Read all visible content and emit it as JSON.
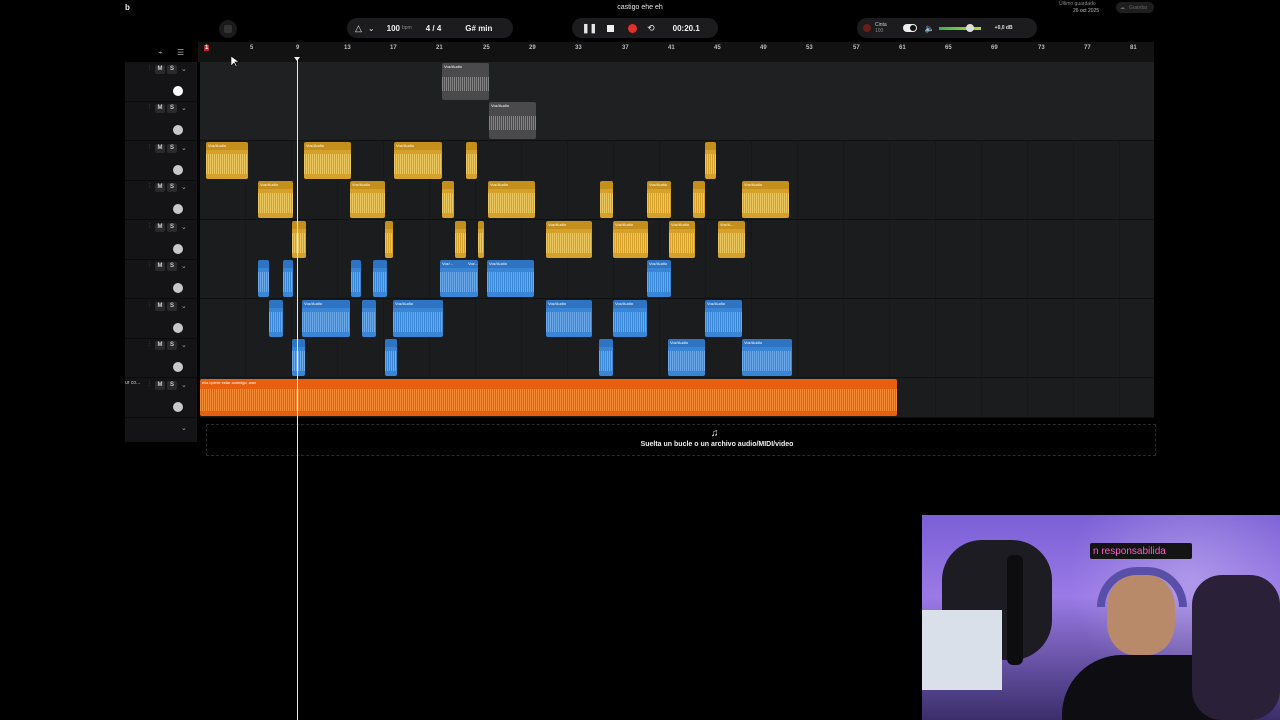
{
  "app": {
    "corner_letter": "b",
    "project_title": "castigo ehe eh",
    "saved_label": "Último guardado",
    "saved_date": "26 oct 2025",
    "save_button": "Guardar"
  },
  "transport": {
    "bpm": "100",
    "bpm_unit": "bpm",
    "time_signature": "4 / 4",
    "key": "G# min",
    "time": "00:20.1",
    "tape_label": "Cinta",
    "tape_value": "100",
    "volume_db": "+0,0 dB"
  },
  "ruler": {
    "bars": [
      "1",
      "5",
      "9",
      "13",
      "17",
      "21",
      "25",
      "29",
      "33",
      "37",
      "41",
      "45",
      "49",
      "53",
      "57",
      "61",
      "65",
      "69",
      "73",
      "77",
      "81"
    ]
  },
  "tracks": [
    {
      "mute": "M",
      "solo": "S",
      "clips": [
        {
          "label": "Voz/Audio",
          "color": "gray"
        }
      ]
    },
    {
      "mute": "M",
      "solo": "S",
      "clips": [
        {
          "label": "Voz/Audio",
          "color": "gray"
        }
      ]
    },
    {
      "mute": "M",
      "solo": "S",
      "clips": [
        {
          "label": "Voz/Audio",
          "color": "gold"
        },
        {
          "label": "Voz/Audio",
          "color": "gold"
        },
        {
          "label": "Voz/Audio",
          "color": "gold"
        },
        {
          "label": "",
          "color": "gold"
        },
        {
          "label": "",
          "color": "gold"
        }
      ]
    },
    {
      "mute": "M",
      "solo": "S",
      "clips": [
        {
          "label": "Voz/Audio",
          "color": "gold"
        },
        {
          "label": "Voz/Audio",
          "color": "gold"
        },
        {
          "label": "",
          "color": "gold"
        },
        {
          "label": "Voz/Audio",
          "color": "gold"
        },
        {
          "label": "",
          "color": "gold"
        },
        {
          "label": "Voz/Audio",
          "color": "gold"
        },
        {
          "label": "",
          "color": "gold"
        },
        {
          "label": "Voz/Audio",
          "color": "gold"
        }
      ]
    },
    {
      "mute": "M",
      "solo": "S",
      "clips": [
        {
          "label": "",
          "color": "gold"
        },
        {
          "label": "",
          "color": "gold"
        },
        {
          "label": "",
          "color": "gold"
        },
        {
          "label": "",
          "color": "gold"
        },
        {
          "label": "Voz/Audio",
          "color": "gold"
        },
        {
          "label": "Voz/Audio",
          "color": "gold"
        },
        {
          "label": "Voz/Audio",
          "color": "gold"
        },
        {
          "label": "Voz/A...",
          "color": "gold"
        }
      ]
    },
    {
      "mute": "M",
      "solo": "S",
      "clips": [
        {
          "label": "",
          "color": "blue"
        },
        {
          "label": "",
          "color": "blue"
        },
        {
          "label": "",
          "color": "blue"
        },
        {
          "label": "",
          "color": "blue"
        },
        {
          "label": "Voz/...",
          "color": "blue"
        },
        {
          "label": "Voz...",
          "color": "blue"
        },
        {
          "label": "Voz/Audio",
          "color": "blue"
        },
        {
          "label": "Voz/Audio",
          "color": "blue"
        }
      ]
    },
    {
      "mute": "M",
      "solo": "S",
      "clips": [
        {
          "label": "",
          "color": "blue"
        },
        {
          "label": "Voz/Audio",
          "color": "blue"
        },
        {
          "label": "",
          "color": "blue"
        },
        {
          "label": "Voz/Audio",
          "color": "blue"
        },
        {
          "label": "Voz/Audio",
          "color": "blue"
        },
        {
          "label": "Voz/Audio",
          "color": "blue"
        },
        {
          "label": "Voz/Audio",
          "color": "blue"
        }
      ]
    },
    {
      "mute": "M",
      "solo": "S",
      "clips": [
        {
          "label": "",
          "color": "blue"
        },
        {
          "label": "",
          "color": "blue"
        },
        {
          "label": "",
          "color": "blue"
        },
        {
          "label": "Voz/Audio",
          "color": "blue"
        },
        {
          "label": "Voz/Audio",
          "color": "blue"
        }
      ]
    },
    {
      "name": "ur co...",
      "mute": "M",
      "solo": "S",
      "clips": [
        {
          "label": "ella quiere estar conmigo .wav",
          "color": "orange"
        }
      ]
    }
  ],
  "dropzone_text": "Suelta un bucle o un archivo audio/MIDI/video",
  "webcam": {
    "sign_text": "n responsabilida"
  },
  "colors": {
    "gold": "#d5a12b",
    "blue": "#3a86d6",
    "orange": "#e8600f",
    "gray": "#4a4a4c",
    "record": "#e0322b"
  }
}
